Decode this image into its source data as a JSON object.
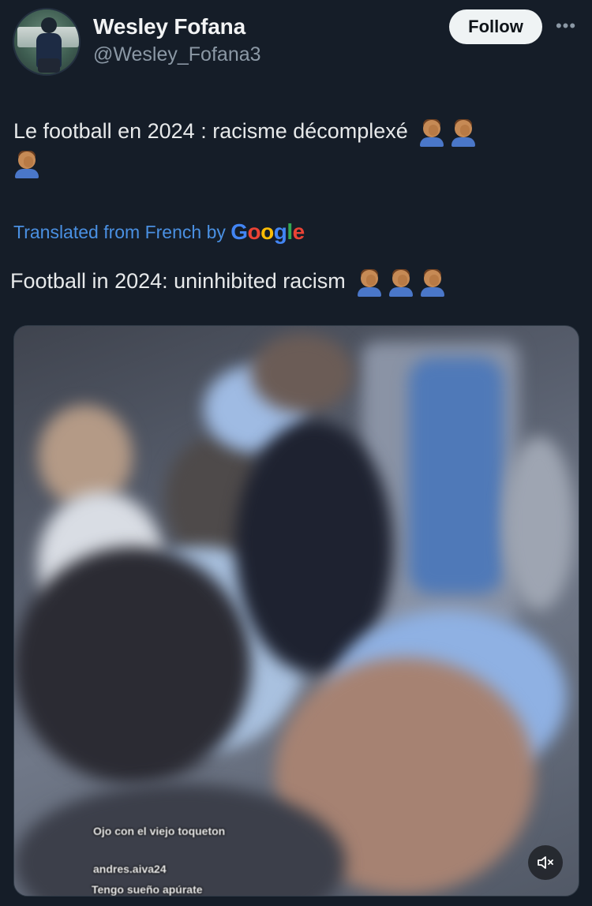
{
  "author": {
    "name": "Wesley Fofana",
    "handle": "@Wesley_Fofana3"
  },
  "actions": {
    "follow_label": "Follow",
    "more_label": "•••"
  },
  "tweet": {
    "text": "Le football en 2024 : racisme décomplexé",
    "translated_prefix": "Translated from French by",
    "translator_brand": [
      "G",
      "o",
      "o",
      "g",
      "l",
      "e"
    ],
    "translation": "Football in 2024: uninhibited racism"
  },
  "video": {
    "captions": [
      "Ojo con el viejo toqueton",
      "andres.aiva24",
      "Tengo sueño apúrate"
    ]
  },
  "colors": {
    "background": "#151d28",
    "link": "#4a90e2",
    "secondary_text": "#8b98a5"
  }
}
